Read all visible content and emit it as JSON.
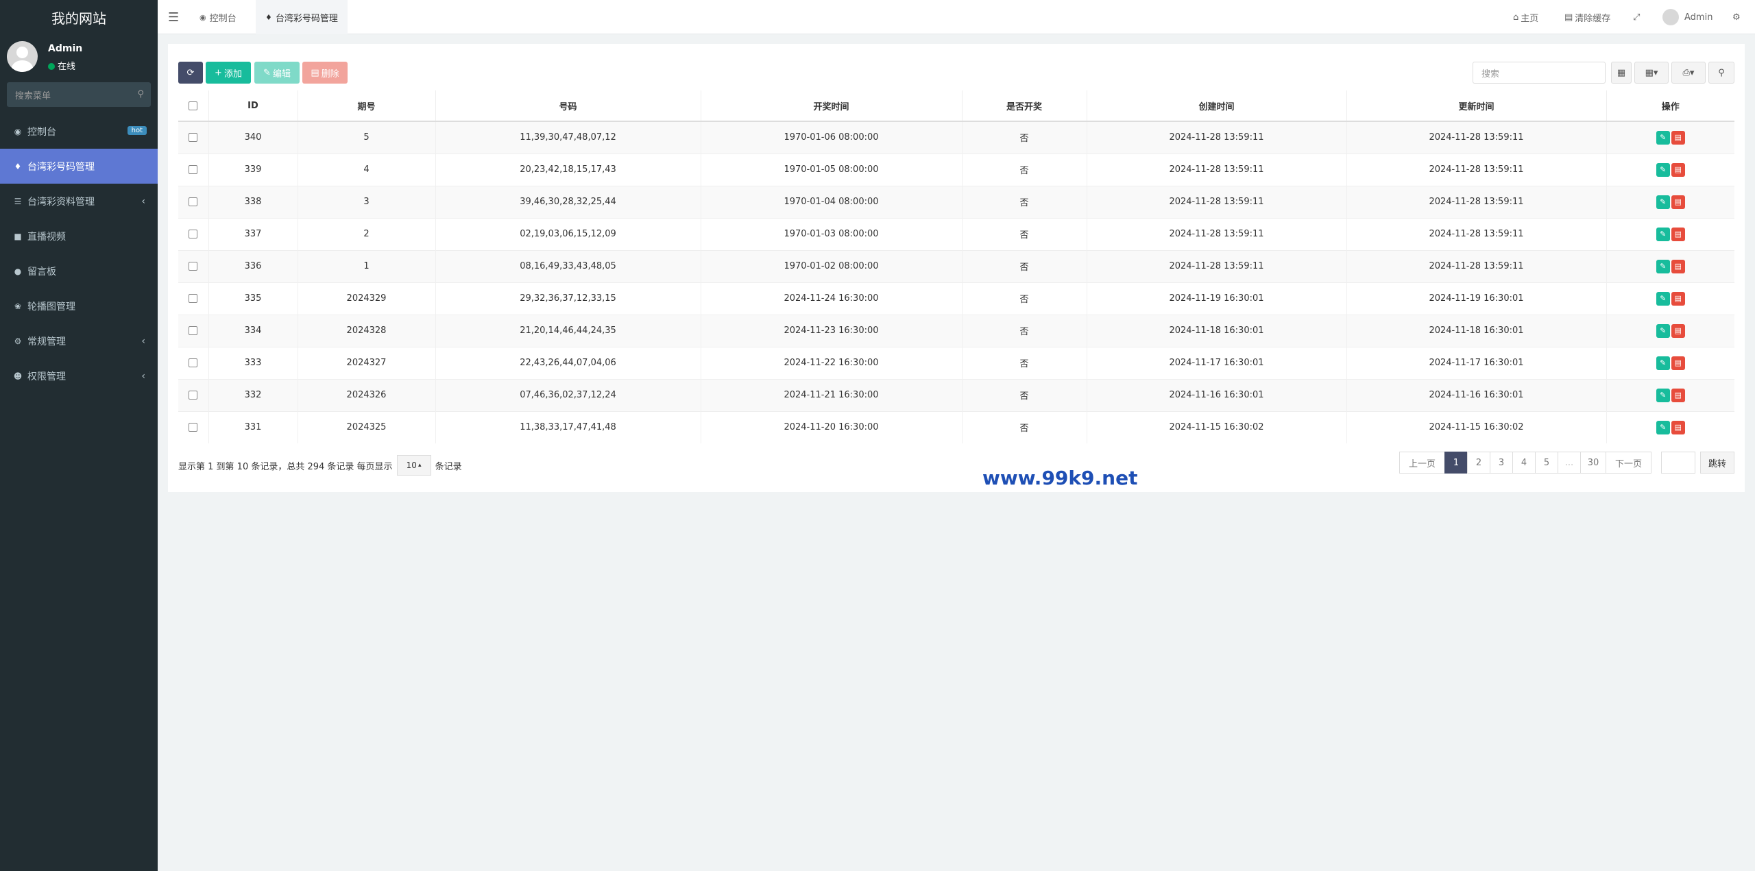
{
  "sidebar": {
    "site_title": "我的网站",
    "user_name": "Admin",
    "user_status": "在线",
    "search_placeholder": "搜索菜单",
    "items": [
      {
        "label": "控制台",
        "icon": "dashboard-icon",
        "badge": "hot"
      },
      {
        "label": "台湾彩号码管理",
        "icon": "bell-icon",
        "active": true
      },
      {
        "label": "台湾彩资料管理",
        "icon": "list-icon",
        "has_children": true
      },
      {
        "label": "直播视频",
        "icon": "video-camera-icon"
      },
      {
        "label": "留言板",
        "icon": "comment-icon"
      },
      {
        "label": "轮播图管理",
        "icon": "leaf-icon"
      },
      {
        "label": "常规管理",
        "icon": "cogs-icon",
        "has_children": true
      },
      {
        "label": "权限管理",
        "icon": "group-icon",
        "has_children": true
      }
    ]
  },
  "topbar": {
    "tabs": [
      {
        "label": "控制台",
        "icon": "dashboard-icon"
      },
      {
        "label": "台湾彩号码管理",
        "icon": "bell-icon",
        "active": true
      }
    ],
    "home": "主页",
    "clear_cache": "清除缓存",
    "user": "Admin"
  },
  "toolbar": {
    "add": "添加",
    "edit": "编辑",
    "delete": "删除",
    "search_placeholder": "搜索"
  },
  "table": {
    "headers": [
      "ID",
      "期号",
      "号码",
      "开奖时间",
      "是否开奖",
      "创建时间",
      "更新时间",
      "操作"
    ],
    "rows": [
      [
        "340",
        "5",
        "11,39,30,47,48,07,12",
        "1970-01-06 08:00:00",
        "否",
        "2024-11-28 13:59:11",
        "2024-11-28 13:59:11"
      ],
      [
        "339",
        "4",
        "20,23,42,18,15,17,43",
        "1970-01-05 08:00:00",
        "否",
        "2024-11-28 13:59:11",
        "2024-11-28 13:59:11"
      ],
      [
        "338",
        "3",
        "39,46,30,28,32,25,44",
        "1970-01-04 08:00:00",
        "否",
        "2024-11-28 13:59:11",
        "2024-11-28 13:59:11"
      ],
      [
        "337",
        "2",
        "02,19,03,06,15,12,09",
        "1970-01-03 08:00:00",
        "否",
        "2024-11-28 13:59:11",
        "2024-11-28 13:59:11"
      ],
      [
        "336",
        "1",
        "08,16,49,33,43,48,05",
        "1970-01-02 08:00:00",
        "否",
        "2024-11-28 13:59:11",
        "2024-11-28 13:59:11"
      ],
      [
        "335",
        "2024329",
        "29,32,36,37,12,33,15",
        "2024-11-24 16:30:00",
        "否",
        "2024-11-19 16:30:01",
        "2024-11-19 16:30:01"
      ],
      [
        "334",
        "2024328",
        "21,20,14,46,44,24,35",
        "2024-11-23 16:30:00",
        "否",
        "2024-11-18 16:30:01",
        "2024-11-18 16:30:01"
      ],
      [
        "333",
        "2024327",
        "22,43,26,44,07,04,06",
        "2024-11-22 16:30:00",
        "否",
        "2024-11-17 16:30:01",
        "2024-11-17 16:30:01"
      ],
      [
        "332",
        "2024326",
        "07,46,36,02,37,12,24",
        "2024-11-21 16:30:00",
        "否",
        "2024-11-16 16:30:01",
        "2024-11-16 16:30:01"
      ],
      [
        "331",
        "2024325",
        "11,38,33,17,47,41,48",
        "2024-11-20 16:30:00",
        "否",
        "2024-11-15 16:30:02",
        "2024-11-15 16:30:02"
      ]
    ]
  },
  "footer": {
    "summary": "显示第 1 到第 10 条记录，总共 294 条记录 每页显示",
    "page_size": "10",
    "suffix": "条记录",
    "pages": [
      "上一页",
      "1",
      "2",
      "3",
      "4",
      "5",
      "...",
      "30",
      "下一页"
    ],
    "active_page": "1",
    "jump": "跳转"
  },
  "watermark": "www.99k9.net",
  "colors": {
    "sidebar": "#222d32",
    "active": "#5e78d3",
    "success": "#18bc9c",
    "danger": "#e74c3c",
    "primary": "#444c69"
  }
}
